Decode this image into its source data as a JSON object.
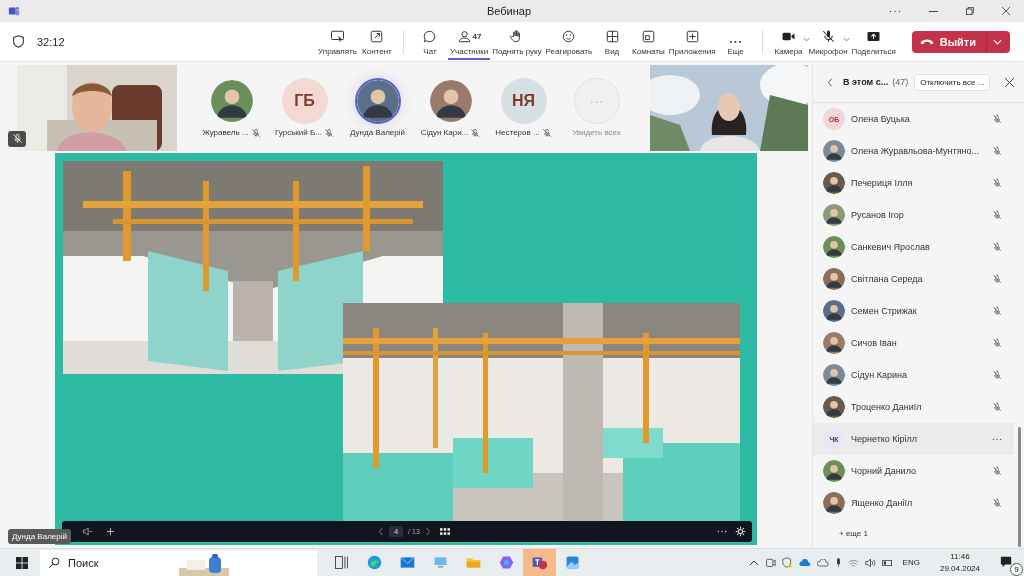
{
  "window": {
    "title": "Вебинар"
  },
  "meeting": {
    "timer": "32:12"
  },
  "toolbar": [
    [
      {
        "label": "Управлять",
        "kind": "button",
        "selected": false
      },
      {
        "label": "Контент",
        "kind": "button",
        "selected": false
      }
    ],
    [
      {
        "label": "Чат",
        "kind": "button",
        "selected": false
      },
      {
        "label": "Участники",
        "kind": "button",
        "selected": true,
        "badge": "47"
      },
      {
        "label": "Поднять руку",
        "kind": "button",
        "selected": false
      },
      {
        "label": "Реагировать",
        "kind": "button",
        "selected": false
      },
      {
        "label": "Вид",
        "kind": "button",
        "selected": false
      },
      {
        "label": "Комнаты",
        "kind": "button",
        "selected": false
      },
      {
        "label": "Приложения",
        "kind": "button",
        "selected": false
      },
      {
        "label": "Еще",
        "kind": "button",
        "selected": false
      }
    ],
    [
      {
        "label": "Камера",
        "kind": "split",
        "selected": false
      },
      {
        "label": "Микрофон",
        "kind": "split",
        "selected": false
      },
      {
        "label": "Поделиться",
        "kind": "button",
        "selected": false
      }
    ]
  ],
  "leave_button": {
    "label": "Выйти"
  },
  "left_video": {
    "muted": true
  },
  "gallery": [
    {
      "name": "Журавель ...",
      "muted": true,
      "active": false
    },
    {
      "name": "Гурський Б...",
      "kind": "initials",
      "initials": "ГБ",
      "color": "#f3d9d3",
      "muted": true,
      "active": false
    },
    {
      "name": "Дунда Валерій",
      "muted": false,
      "active": true
    },
    {
      "name": "Сідун Кари...",
      "muted": true,
      "active": false
    },
    {
      "name": "Нестеров ...",
      "kind": "initials",
      "initials": "НЯ",
      "color": "#d6e0e3",
      "muted": true,
      "active": false
    },
    {
      "name": "Увидеть всех",
      "kind": "more",
      "initials": "···"
    }
  ],
  "slide": {
    "presenter": "Дунда Валерій",
    "page": "4",
    "total": "/ 13"
  },
  "panel": {
    "title": "В этом с...",
    "count": "(47)",
    "mute_all": "Отключить все ...",
    "more": "+ еще 1",
    "people": [
      {
        "name": "Олена Буцька",
        "kind": "initials",
        "initials": "ОБ",
        "muted": true,
        "selected": false
      },
      {
        "name": "Олена Журавльова-Мунтяно...",
        "muted": true,
        "selected": false
      },
      {
        "name": "Печериця Ілля",
        "muted": true,
        "selected": false
      },
      {
        "name": "Русанов Ігор",
        "muted": true,
        "selected": false
      },
      {
        "name": "Санкевич Ярослав",
        "muted": true,
        "selected": false
      },
      {
        "name": "Світлана Середа",
        "muted": true,
        "selected": false
      },
      {
        "name": "Семен Стрижак",
        "muted": true,
        "selected": false
      },
      {
        "name": "Сичов Іван",
        "muted": true,
        "selected": false
      },
      {
        "name": "Сідун Карина",
        "muted": true,
        "selected": false
      },
      {
        "name": "Троценко Даниїл",
        "muted": true,
        "selected": false
      },
      {
        "name": "Чернетко Кірілл",
        "kind": "initials",
        "initials": "ЧК",
        "muted": false,
        "selected": true
      },
      {
        "name": "Чорний Данило",
        "muted": true,
        "selected": false
      },
      {
        "name": "Ященко Даніїл",
        "muted": true,
        "selected": false
      }
    ]
  },
  "taskbar": {
    "search_placeholder": "Поиск",
    "apps": [
      {
        "selected": false
      },
      {
        "selected": false
      },
      {
        "selected": false
      },
      {
        "selected": false
      },
      {
        "selected": false
      },
      {
        "selected": false
      },
      {
        "selected": true
      },
      {
        "selected": false
      }
    ],
    "language": "ENG",
    "time": "11:46",
    "date": "29.04.2024",
    "notifications": "9"
  }
}
